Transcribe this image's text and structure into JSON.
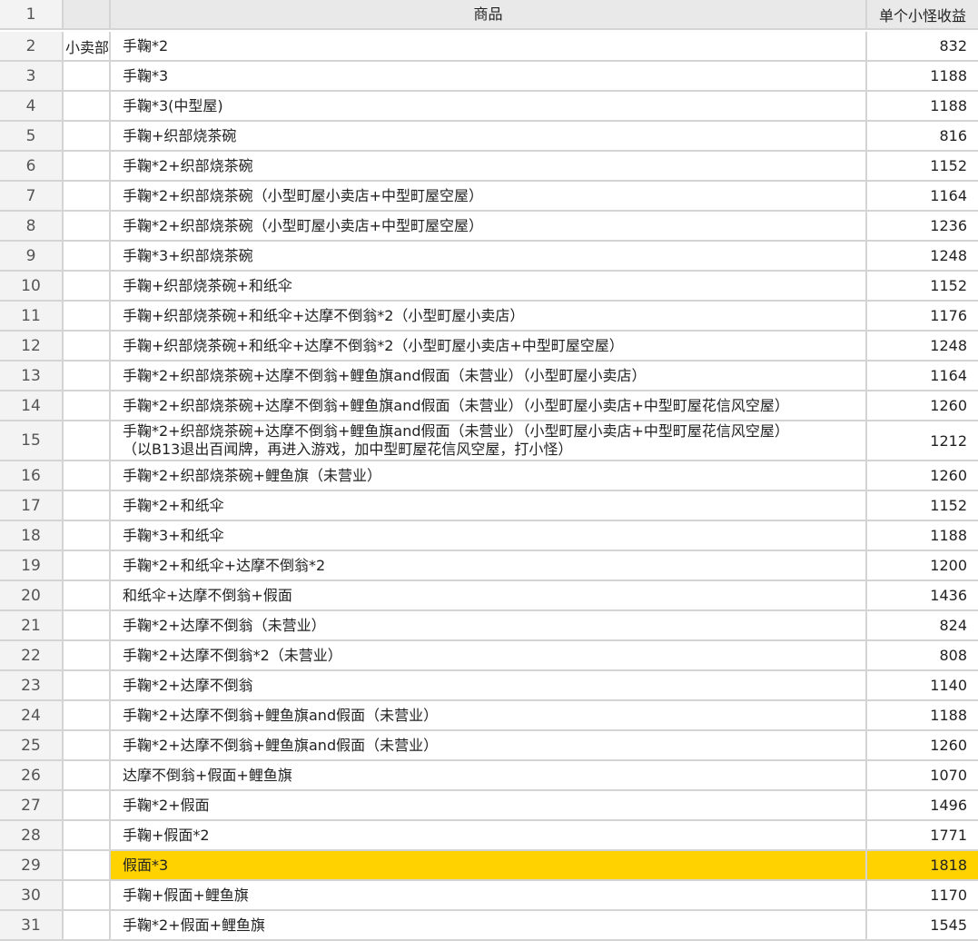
{
  "header": {
    "row_num": "1",
    "col_a": "",
    "col_b": "商品",
    "col_c": "单个小怪收益"
  },
  "rows": [
    {
      "n": "2",
      "a": "小卖部",
      "b": "手鞠*2",
      "c": "832"
    },
    {
      "n": "3",
      "a": "",
      "b": "手鞠*3",
      "c": "1188"
    },
    {
      "n": "4",
      "a": "",
      "b": "手鞠*3(中型屋)",
      "c": "1188"
    },
    {
      "n": "5",
      "a": "",
      "b": "手鞠+织部烧茶碗",
      "c": "816"
    },
    {
      "n": "6",
      "a": "",
      "b": "手鞠*2+织部烧茶碗",
      "c": "1152"
    },
    {
      "n": "7",
      "a": "",
      "b": "手鞠*2+织部烧茶碗（小型町屋小卖店+中型町屋空屋）",
      "c": "1164"
    },
    {
      "n": "8",
      "a": "",
      "b": "手鞠*2+织部烧茶碗（小型町屋小卖店+中型町屋空屋）",
      "c": "1236"
    },
    {
      "n": "9",
      "a": "",
      "b": "手鞠*3+织部烧茶碗",
      "c": "1248"
    },
    {
      "n": "10",
      "a": "",
      "b": "手鞠+织部烧茶碗+和纸伞",
      "c": "1152"
    },
    {
      "n": "11",
      "a": "",
      "b": "手鞠+织部烧茶碗+和纸伞+达摩不倒翁*2（小型町屋小卖店）",
      "c": "1176"
    },
    {
      "n": "12",
      "a": "",
      "b": "手鞠+织部烧茶碗+和纸伞+达摩不倒翁*2（小型町屋小卖店+中型町屋空屋）",
      "c": "1248"
    },
    {
      "n": "13",
      "a": "",
      "b": "手鞠*2+织部烧茶碗+达摩不倒翁+鲤鱼旗and假面（未营业）（小型町屋小卖店）",
      "c": "1164"
    },
    {
      "n": "14",
      "a": "",
      "b": "手鞠*2+织部烧茶碗+达摩不倒翁+鲤鱼旗and假面（未营业）（小型町屋小卖店+中型町屋花信风空屋）",
      "c": "1260"
    },
    {
      "n": "15",
      "a": "",
      "b": "手鞠*2+织部烧茶碗+达摩不倒翁+鲤鱼旗and假面（未营业）（小型町屋小卖店+中型町屋花信风空屋）",
      "b2": "（以B13退出百闻牌，再进入游戏，加中型町屋花信风空屋，打小怪）",
      "c": "1212"
    },
    {
      "n": "16",
      "a": "",
      "b": "手鞠*2+织部烧茶碗+鲤鱼旗（未营业）",
      "c": "1260"
    },
    {
      "n": "17",
      "a": "",
      "b": "手鞠*2+和纸伞",
      "c": "1152"
    },
    {
      "n": "18",
      "a": "",
      "b": "手鞠*3+和纸伞",
      "c": "1188"
    },
    {
      "n": "19",
      "a": "",
      "b": "手鞠*2+和纸伞+达摩不倒翁*2",
      "c": "1200"
    },
    {
      "n": "20",
      "a": "",
      "b": "和纸伞+达摩不倒翁+假面",
      "c": "1436"
    },
    {
      "n": "21",
      "a": "",
      "b": "手鞠*2+达摩不倒翁（未营业）",
      "c": "824"
    },
    {
      "n": "22",
      "a": "",
      "b": "手鞠*2+达摩不倒翁*2（未营业）",
      "c": "808"
    },
    {
      "n": "23",
      "a": "",
      "b": "手鞠*2+达摩不倒翁",
      "c": "1140"
    },
    {
      "n": "24",
      "a": "",
      "b": "手鞠*2+达摩不倒翁+鲤鱼旗and假面（未营业）",
      "c": "1188"
    },
    {
      "n": "25",
      "a": "",
      "b": "手鞠*2+达摩不倒翁+鲤鱼旗and假面（未营业）",
      "c": "1260"
    },
    {
      "n": "26",
      "a": "",
      "b": "达摩不倒翁+假面+鲤鱼旗",
      "c": "1070"
    },
    {
      "n": "27",
      "a": "",
      "b": "手鞠*2+假面",
      "c": "1496"
    },
    {
      "n": "28",
      "a": "",
      "b": "手鞠+假面*2",
      "c": "1771"
    },
    {
      "n": "29",
      "a": "",
      "b": "假面*3",
      "c": "1818",
      "highlight": true
    },
    {
      "n": "30",
      "a": "",
      "b": "手鞠+假面+鲤鱼旗",
      "c": "1170"
    },
    {
      "n": "31",
      "a": "",
      "b": "手鞠*2+假面+鲤鱼旗",
      "c": "1545"
    }
  ],
  "colors": {
    "highlight": "#ffd200",
    "header_bg": "#e9e9e9",
    "gridline": "#d4d4d4"
  }
}
